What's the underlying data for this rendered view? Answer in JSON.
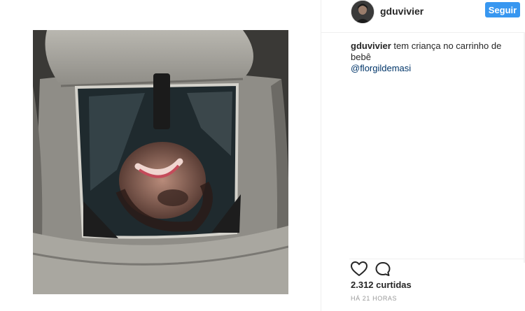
{
  "post": {
    "username": "gduvivier",
    "follow_label": "Seguir",
    "caption_user": "gduvivier",
    "caption_text": "tem criança no carrinho de bebê",
    "caption_mention": "@florgildemasi",
    "likes_text": "2.312 curtidas",
    "time_text": "HÁ 21 HORAS"
  },
  "colors": {
    "follow_button": "#3897f0",
    "mention": "#003569"
  },
  "icons": {
    "like": "heart-icon",
    "comment": "comment-icon"
  }
}
